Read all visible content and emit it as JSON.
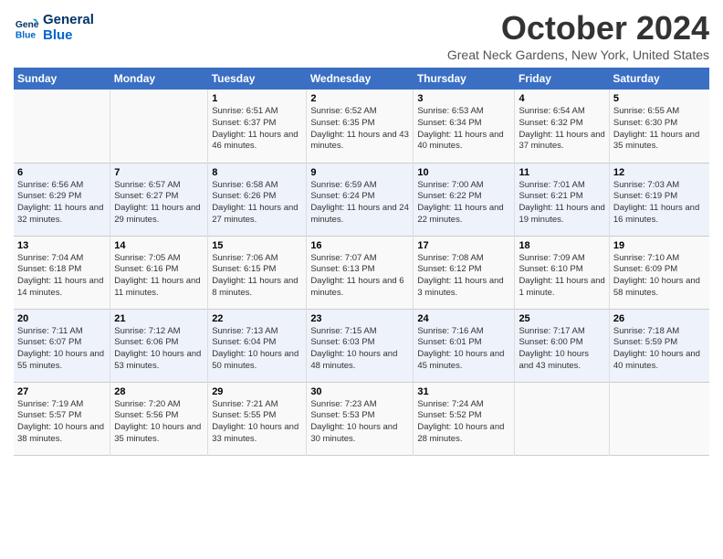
{
  "header": {
    "logo_line1": "General",
    "logo_line2": "Blue",
    "month": "October 2024",
    "location": "Great Neck Gardens, New York, United States"
  },
  "weekdays": [
    "Sunday",
    "Monday",
    "Tuesday",
    "Wednesday",
    "Thursday",
    "Friday",
    "Saturday"
  ],
  "weeks": [
    [
      {
        "day": "",
        "text": ""
      },
      {
        "day": "",
        "text": ""
      },
      {
        "day": "1",
        "text": "Sunrise: 6:51 AM\nSunset: 6:37 PM\nDaylight: 11 hours and 46 minutes."
      },
      {
        "day": "2",
        "text": "Sunrise: 6:52 AM\nSunset: 6:35 PM\nDaylight: 11 hours and 43 minutes."
      },
      {
        "day": "3",
        "text": "Sunrise: 6:53 AM\nSunset: 6:34 PM\nDaylight: 11 hours and 40 minutes."
      },
      {
        "day": "4",
        "text": "Sunrise: 6:54 AM\nSunset: 6:32 PM\nDaylight: 11 hours and 37 minutes."
      },
      {
        "day": "5",
        "text": "Sunrise: 6:55 AM\nSunset: 6:30 PM\nDaylight: 11 hours and 35 minutes."
      }
    ],
    [
      {
        "day": "6",
        "text": "Sunrise: 6:56 AM\nSunset: 6:29 PM\nDaylight: 11 hours and 32 minutes."
      },
      {
        "day": "7",
        "text": "Sunrise: 6:57 AM\nSunset: 6:27 PM\nDaylight: 11 hours and 29 minutes."
      },
      {
        "day": "8",
        "text": "Sunrise: 6:58 AM\nSunset: 6:26 PM\nDaylight: 11 hours and 27 minutes."
      },
      {
        "day": "9",
        "text": "Sunrise: 6:59 AM\nSunset: 6:24 PM\nDaylight: 11 hours and 24 minutes."
      },
      {
        "day": "10",
        "text": "Sunrise: 7:00 AM\nSunset: 6:22 PM\nDaylight: 11 hours and 22 minutes."
      },
      {
        "day": "11",
        "text": "Sunrise: 7:01 AM\nSunset: 6:21 PM\nDaylight: 11 hours and 19 minutes."
      },
      {
        "day": "12",
        "text": "Sunrise: 7:03 AM\nSunset: 6:19 PM\nDaylight: 11 hours and 16 minutes."
      }
    ],
    [
      {
        "day": "13",
        "text": "Sunrise: 7:04 AM\nSunset: 6:18 PM\nDaylight: 11 hours and 14 minutes."
      },
      {
        "day": "14",
        "text": "Sunrise: 7:05 AM\nSunset: 6:16 PM\nDaylight: 11 hours and 11 minutes."
      },
      {
        "day": "15",
        "text": "Sunrise: 7:06 AM\nSunset: 6:15 PM\nDaylight: 11 hours and 8 minutes."
      },
      {
        "day": "16",
        "text": "Sunrise: 7:07 AM\nSunset: 6:13 PM\nDaylight: 11 hours and 6 minutes."
      },
      {
        "day": "17",
        "text": "Sunrise: 7:08 AM\nSunset: 6:12 PM\nDaylight: 11 hours and 3 minutes."
      },
      {
        "day": "18",
        "text": "Sunrise: 7:09 AM\nSunset: 6:10 PM\nDaylight: 11 hours and 1 minute."
      },
      {
        "day": "19",
        "text": "Sunrise: 7:10 AM\nSunset: 6:09 PM\nDaylight: 10 hours and 58 minutes."
      }
    ],
    [
      {
        "day": "20",
        "text": "Sunrise: 7:11 AM\nSunset: 6:07 PM\nDaylight: 10 hours and 55 minutes."
      },
      {
        "day": "21",
        "text": "Sunrise: 7:12 AM\nSunset: 6:06 PM\nDaylight: 10 hours and 53 minutes."
      },
      {
        "day": "22",
        "text": "Sunrise: 7:13 AM\nSunset: 6:04 PM\nDaylight: 10 hours and 50 minutes."
      },
      {
        "day": "23",
        "text": "Sunrise: 7:15 AM\nSunset: 6:03 PM\nDaylight: 10 hours and 48 minutes."
      },
      {
        "day": "24",
        "text": "Sunrise: 7:16 AM\nSunset: 6:01 PM\nDaylight: 10 hours and 45 minutes."
      },
      {
        "day": "25",
        "text": "Sunrise: 7:17 AM\nSunset: 6:00 PM\nDaylight: 10 hours and 43 minutes."
      },
      {
        "day": "26",
        "text": "Sunrise: 7:18 AM\nSunset: 5:59 PM\nDaylight: 10 hours and 40 minutes."
      }
    ],
    [
      {
        "day": "27",
        "text": "Sunrise: 7:19 AM\nSunset: 5:57 PM\nDaylight: 10 hours and 38 minutes."
      },
      {
        "day": "28",
        "text": "Sunrise: 7:20 AM\nSunset: 5:56 PM\nDaylight: 10 hours and 35 minutes."
      },
      {
        "day": "29",
        "text": "Sunrise: 7:21 AM\nSunset: 5:55 PM\nDaylight: 10 hours and 33 minutes."
      },
      {
        "day": "30",
        "text": "Sunrise: 7:23 AM\nSunset: 5:53 PM\nDaylight: 10 hours and 30 minutes."
      },
      {
        "day": "31",
        "text": "Sunrise: 7:24 AM\nSunset: 5:52 PM\nDaylight: 10 hours and 28 minutes."
      },
      {
        "day": "",
        "text": ""
      },
      {
        "day": "",
        "text": ""
      }
    ]
  ]
}
